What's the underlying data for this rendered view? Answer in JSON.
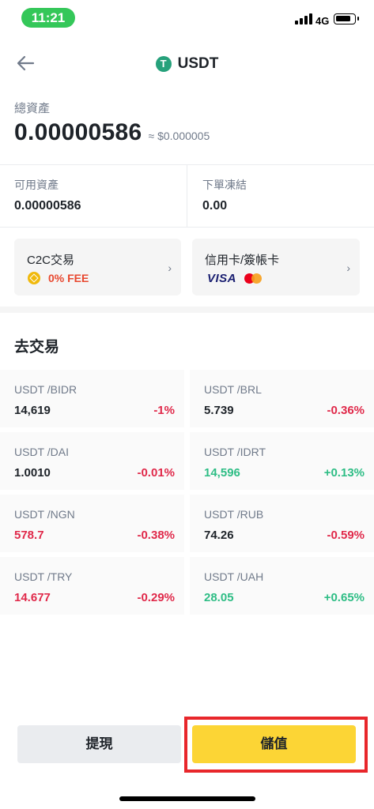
{
  "status_bar": {
    "time": "11:21",
    "network": "4G"
  },
  "header": {
    "title": "USDT",
    "back_icon": "arrow-left-icon",
    "coin_icon": "tether-icon"
  },
  "assets": {
    "total_label": "總資產",
    "total_value": "0.00000586",
    "total_fiat": "≈ $0.000005",
    "available_label": "可用資產",
    "available_value": "0.00000586",
    "frozen_label": "下單凍結",
    "frozen_value": "0.00"
  },
  "cards": {
    "c2c": {
      "title": "C2C交易",
      "fee": "0% FEE",
      "icon": "bnb-icon"
    },
    "card_payment": {
      "title": "信用卡/簽帳卡",
      "visa": "VISA",
      "icon": "mastercard-icon"
    }
  },
  "section": {
    "title": "去交易"
  },
  "markets": [
    {
      "pair": "USDT /BIDR",
      "price": "14,619",
      "change": "-1%",
      "price_color": "#1e2329",
      "change_color": "#e0294a"
    },
    {
      "pair": "USDT /BRL",
      "price": "5.739",
      "change": "-0.36%",
      "price_color": "#1e2329",
      "change_color": "#e0294a"
    },
    {
      "pair": "USDT /DAI",
      "price": "1.0010",
      "change": "-0.01%",
      "price_color": "#1e2329",
      "change_color": "#e0294a"
    },
    {
      "pair": "USDT /IDRT",
      "price": "14,596",
      "change": "+0.13%",
      "price_color": "#2ebd85",
      "change_color": "#2ebd85"
    },
    {
      "pair": "USDT /NGN",
      "price": "578.7",
      "change": "-0.38%",
      "price_color": "#e0294a",
      "change_color": "#e0294a"
    },
    {
      "pair": "USDT /RUB",
      "price": "74.26",
      "change": "-0.59%",
      "price_color": "#1e2329",
      "change_color": "#e0294a"
    },
    {
      "pair": "USDT /TRY",
      "price": "14.677",
      "change": "-0.29%",
      "price_color": "#e0294a",
      "change_color": "#e0294a"
    },
    {
      "pair": "USDT /UAH",
      "price": "28.05",
      "change": "+0.65%",
      "price_color": "#2ebd85",
      "change_color": "#2ebd85"
    }
  ],
  "buttons": {
    "withdraw": "提現",
    "deposit": "儲值"
  },
  "colors": {
    "accent": "#fcd535",
    "up": "#2ebd85",
    "down": "#e0294a",
    "highlight": "#e8262b"
  }
}
